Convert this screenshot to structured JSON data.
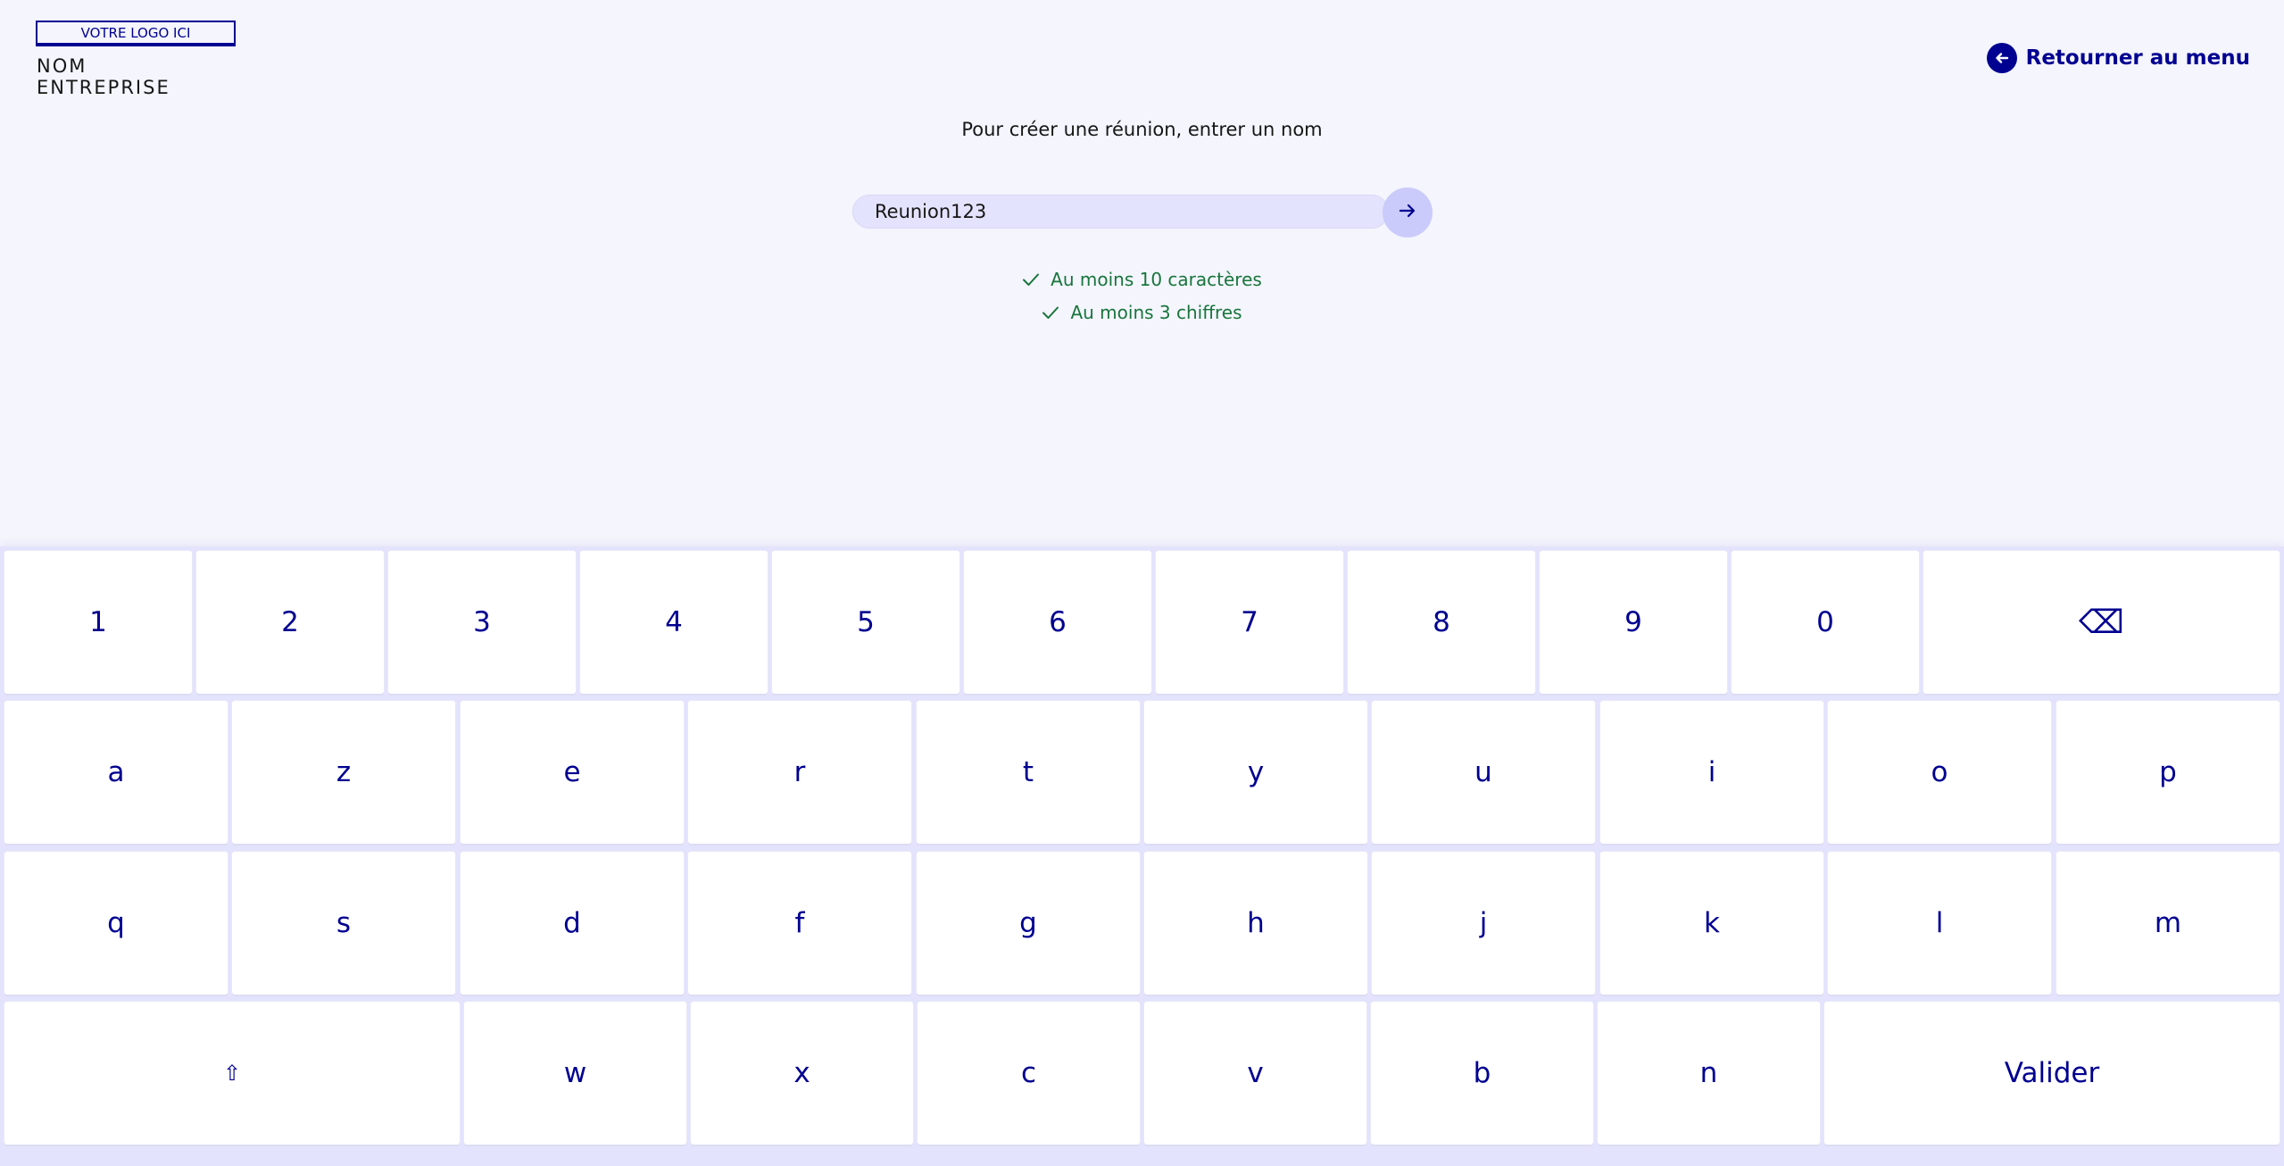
{
  "header": {
    "logo_label": "VOTRE LOGO ICI",
    "company_line1": "NOM",
    "company_line2": "ENTREPRISE",
    "back_label": "Retourner au menu",
    "back_icon": "arrow-left-circle-icon"
  },
  "form": {
    "prompt": "Pour créer une réunion, entrer un nom",
    "input_value": "Reunion123",
    "submit_icon": "arrow-right-icon",
    "rules": [
      {
        "label": "Au moins 10 caractères",
        "valid": true
      },
      {
        "label": "Au moins 3 chiffres",
        "valid": true
      }
    ]
  },
  "keyboard": {
    "row1": [
      "1",
      "2",
      "3",
      "4",
      "5",
      "6",
      "7",
      "8",
      "9",
      "0"
    ],
    "backspace": "⌫",
    "row2": [
      "a",
      "z",
      "e",
      "r",
      "t",
      "y",
      "u",
      "i",
      "o",
      "p"
    ],
    "row3": [
      "q",
      "s",
      "d",
      "f",
      "g",
      "h",
      "j",
      "k",
      "l",
      "m"
    ],
    "shift": "⇧",
    "row4": [
      "w",
      "x",
      "c",
      "v",
      "b",
      "n"
    ],
    "validate": "Valider"
  },
  "colors": {
    "primary": "#000091",
    "background": "#f4f5fd",
    "success": "#18753c",
    "input_bg": "#e3e3fd"
  }
}
